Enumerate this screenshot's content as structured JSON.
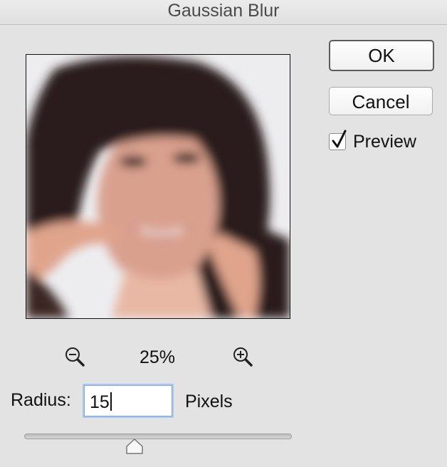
{
  "window": {
    "title": "Gaussian Blur"
  },
  "buttons": {
    "ok_label": "OK",
    "cancel_label": "Cancel"
  },
  "preview_option": {
    "label": "Preview",
    "checked": true
  },
  "preview": {
    "description_icon": "blurred-photo-preview",
    "zoom_level": "25%"
  },
  "zoom_controls": {
    "zoom_out_icon": "zoom-out-icon",
    "zoom_in_icon": "zoom-in-icon"
  },
  "radius": {
    "label": "Radius:",
    "value": "15",
    "units": "Pixels",
    "slider_fraction": 0.41
  },
  "colors": {
    "dialog_background": "#e3e3e3",
    "focus_ring": "#a9c8ec",
    "default_button_border": "#5c5c5c"
  }
}
